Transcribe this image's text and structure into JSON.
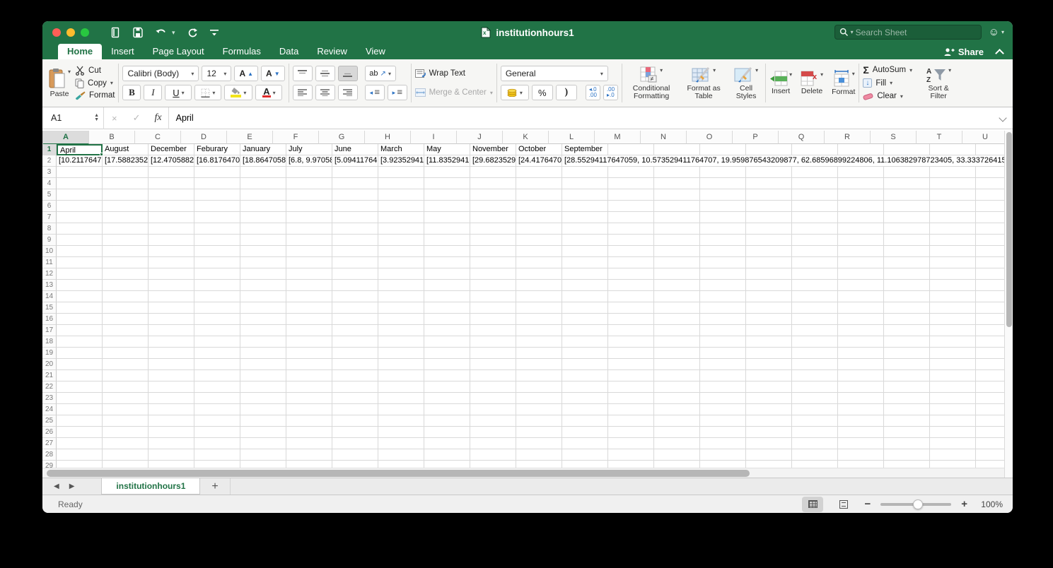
{
  "window_title": "institutionhours1",
  "titlebar": {
    "search_placeholder": "Search Sheet"
  },
  "menu_tabs": [
    {
      "label": "Home",
      "active": true
    },
    {
      "label": "Insert",
      "active": false
    },
    {
      "label": "Page Layout",
      "active": false
    },
    {
      "label": "Formulas",
      "active": false
    },
    {
      "label": "Data",
      "active": false
    },
    {
      "label": "Review",
      "active": false
    },
    {
      "label": "View",
      "active": false
    }
  ],
  "share_label": "Share",
  "ribbon": {
    "paste_label": "Paste",
    "cut_label": "Cut",
    "copy_label": "Copy",
    "format_label": "Format",
    "font_name": "Calibri (Body)",
    "font_size": "12",
    "grow_font": "A",
    "shrink_font": "A",
    "bold": "B",
    "italic": "I",
    "underline": "U",
    "orientation": "ab",
    "wrap_text_label": "Wrap Text",
    "merge_center_label": "Merge & Center",
    "number_format": "General",
    "percent": "%",
    "comma_style": ")",
    "inc_decimal": "◂.0\n.00",
    "dec_decimal": ".00\n▸.0",
    "conditional_formatting_label": "Conditional Formatting",
    "format_as_table_label": "Format as Table",
    "cell_styles_label": "Cell Styles",
    "insert_label": "Insert",
    "delete_label": "Delete",
    "format_cells_label": "Format",
    "autosum_icon": "Σ",
    "autosum_label": "AutoSum",
    "fill_label": "Fill",
    "clear_label": "Clear",
    "sort_filter_label": "Sort & Filter",
    "sort_a": "A",
    "sort_z": "Z"
  },
  "formula_bar": {
    "name_box": "A1",
    "fx": "fx",
    "content": "April"
  },
  "grid": {
    "column_headers": [
      "A",
      "B",
      "C",
      "D",
      "E",
      "F",
      "G",
      "H",
      "I",
      "J",
      "K",
      "L",
      "M",
      "N",
      "O",
      "P",
      "Q",
      "R",
      "S",
      "T",
      "U"
    ],
    "selected_column": "A",
    "selected_cell": "A1",
    "visible_rows": 29,
    "row_values": {
      "1": [
        "April",
        "August",
        "December",
        "Feburary",
        "January",
        "July",
        "June",
        "March",
        "May",
        "November",
        "October",
        "September"
      ],
      "2": [
        "[10.2117647",
        "[17.5882352",
        "[12.4705882",
        "[16.8176470",
        "[18.8647058",
        "[6.8, 9.97058",
        "[5.09411764",
        "[3.92352941",
        "[11.8352941",
        "[29.6823529",
        "[24.4176470",
        "[28.55294117647059, 10.573529411764707, 19.959876543209877, 62.68596899224806, 11.106382978723405, 33.333726415"
      ]
    },
    "overflow_cell": "L2"
  },
  "sheet_tabbar": {
    "active_tab": "institutionhours1",
    "add_label": "+"
  },
  "status_bar": {
    "status": "Ready",
    "zoom_level": "100%"
  }
}
